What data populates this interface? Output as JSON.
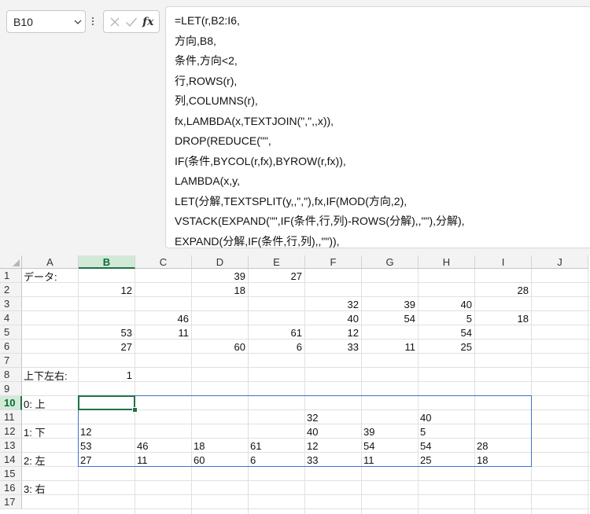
{
  "namebox": {
    "value": "B10"
  },
  "formula_bar": {
    "cancel_icon": "x-icon",
    "enter_icon": "check-icon",
    "fx_label": "fx",
    "lines": [
      "=LET(r,B2:I6,",
      "方向,B8,",
      "条件,方向<2,",
      "行,ROWS(r),",
      "列,COLUMNS(r),",
      "fx,LAMBDA(x,TEXTJOIN(\",\",,x)),",
      "DROP(REDUCE(\"\",",
      "IF(条件,BYCOL(r,fx),BYROW(r,fx)),",
      "LAMBDA(x,y,",
      "LET(分解,TEXTSPLIT(y,,\",\"),fx,IF(MOD(方向,2),",
      "VSTACK(EXPAND(\"\",IF(条件,行,列)-ROWS(分解),,\"\"),分解),",
      "EXPAND(分解,IF(条件,行,列),,\"\")),"
    ]
  },
  "grid": {
    "columns": [
      "A",
      "B",
      "C",
      "D",
      "E",
      "F",
      "G",
      "H",
      "I",
      "J"
    ],
    "selected_column": "B",
    "rows": [
      "1",
      "2",
      "3",
      "4",
      "5",
      "6",
      "7",
      "8",
      "9",
      "10",
      "11",
      "12",
      "13",
      "14",
      "15",
      "16",
      "17"
    ],
    "selected_row": "10",
    "active_cell": "B10",
    "cells": {
      "A1": "データ:",
      "D1": "39",
      "E1": "27",
      "B2": "12",
      "D2": "18",
      "I2": "28",
      "F3": "32",
      "G3": "39",
      "H3": "40",
      "C4": "46",
      "F4": "40",
      "G4": "54",
      "H4": "5",
      "I4": "18",
      "B5": "53",
      "C5": "11",
      "E5": "61",
      "F5": "12",
      "H5": "54",
      "B6": "27",
      "D6": "60",
      "E6": "6",
      "F6": "33",
      "G6": "11",
      "H6": "25",
      "A8": "上下左右:",
      "B8": "1",
      "A10": "0: 上",
      "F11": "32",
      "H11": "40",
      "A12": "1: 下",
      "B12": "12",
      "F12": "40",
      "G12": "39",
      "H12": "5",
      "B13": "53",
      "C13": "46",
      "D13": "18",
      "E13": "61",
      "F13": "12",
      "G13": "54",
      "H13": "54",
      "I13": "28",
      "A14": "2: 左",
      "B14": "27",
      "C14": "11",
      "D14": "60",
      "E14": "6",
      "F14": "33",
      "G14": "11",
      "H14": "25",
      "I14": "18",
      "A16": "3: 右"
    }
  }
}
